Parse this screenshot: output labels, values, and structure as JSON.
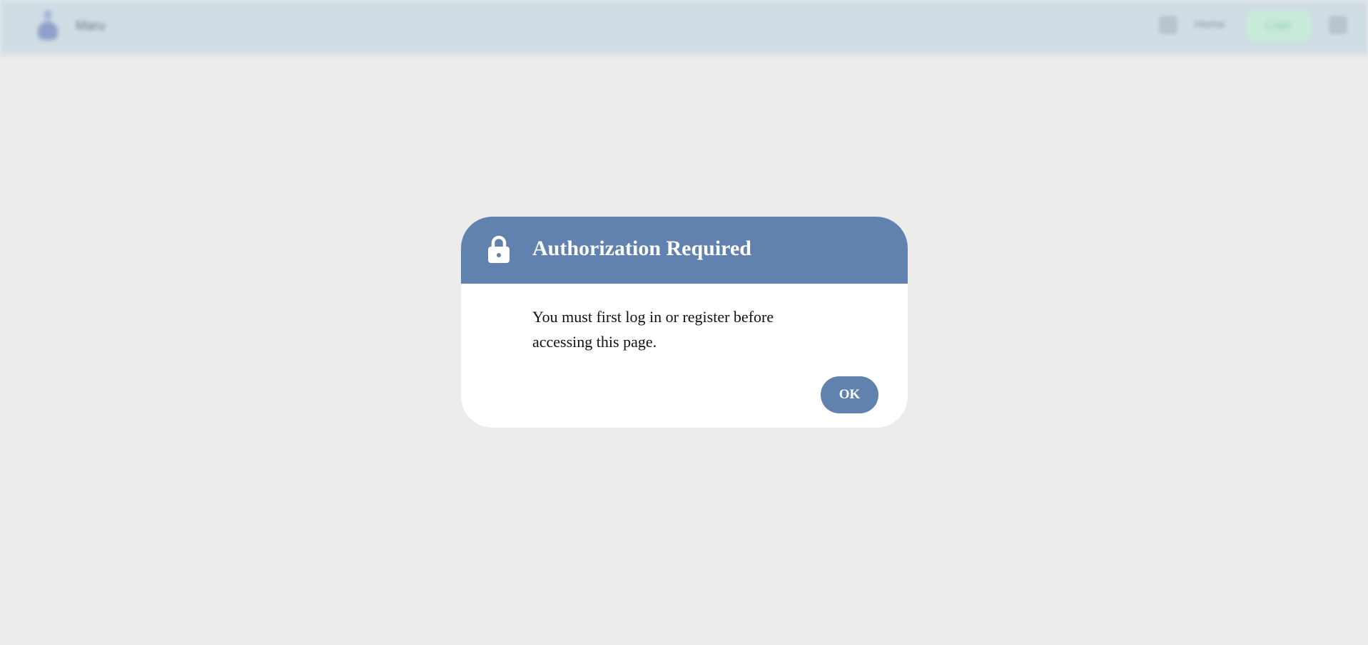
{
  "header": {
    "brand": "Maru",
    "nav_link": "Home",
    "cta_label": "Login",
    "logo_icon": "person-logo-icon",
    "search_icon": "search-icon",
    "menu_icon": "menu-icon"
  },
  "modal": {
    "icon": "lock-icon",
    "title": "Authorization Required",
    "message": "You must first log in or register before accessing this page.",
    "ok_label": "OK"
  },
  "colors": {
    "accent": "#6181ae",
    "page_background": "#ececec",
    "header_background": "#d1dde4",
    "cta_background": "#c7ead9"
  }
}
